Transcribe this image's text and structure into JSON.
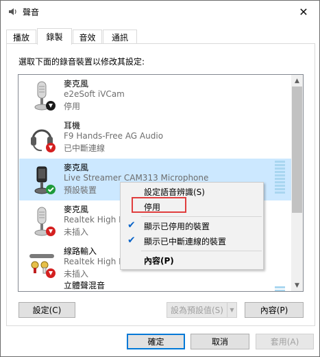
{
  "window": {
    "title": "聲音",
    "close_glyph": "✕"
  },
  "tabs": [
    "播放",
    "錄製",
    "音效",
    "通訊"
  ],
  "instruction": "選取下面的錄音裝置以修改其設定:",
  "devices": [
    {
      "name": "麥克風",
      "description": "e2eSoft iVCam",
      "state": "停用",
      "icon": "microphone-icon",
      "badge": "down-arrow-badge",
      "selected": false
    },
    {
      "name": "耳機",
      "description": "F9 Hands-Free AG Audio",
      "state": "已中斷連線",
      "icon": "headset-icon",
      "badge": "red-down-arrow-badge",
      "selected": false
    },
    {
      "name": "麥克風",
      "description": "Live Streamer CAM313 Microphone",
      "state": "預設裝置",
      "icon": "microphone-icon",
      "badge": "green-check-badge",
      "selected": true
    },
    {
      "name": "麥克風",
      "description": "Realtek High D",
      "state": "未插入",
      "icon": "microphone-icon",
      "badge": "red-down-arrow-badge",
      "selected": false
    },
    {
      "name": "線路輸入",
      "description": "Realtek High D",
      "state": "未插入",
      "icon": "line-in-jack-icon",
      "badge": "red-down-arrow-badge",
      "selected": false
    },
    {
      "name": "立體聲混音",
      "description": "",
      "state": "",
      "icon": "board-icon",
      "badge": "",
      "selected": false
    }
  ],
  "context_menu": {
    "items": [
      {
        "label": "設定語音辨識(S)",
        "checked": false,
        "bold": false
      },
      {
        "label": "停用",
        "checked": false,
        "bold": false
      },
      {
        "label": "顯示已停用的裝置",
        "checked": true,
        "bold": false
      },
      {
        "label": "顯示已中斷連線的裝置",
        "checked": true,
        "bold": false
      },
      {
        "label": "內容(P)",
        "checked": false,
        "bold": true
      }
    ]
  },
  "buttons": {
    "configure": "設定(C)",
    "set_default": "設為預設值(S)",
    "properties": "內容(P)",
    "ok": "確定",
    "cancel": "取消",
    "apply": "套用(A)"
  },
  "colors": {
    "selection": "#cce8ff",
    "accent": "#0078d7",
    "highlight_box": "#e03c3c"
  }
}
